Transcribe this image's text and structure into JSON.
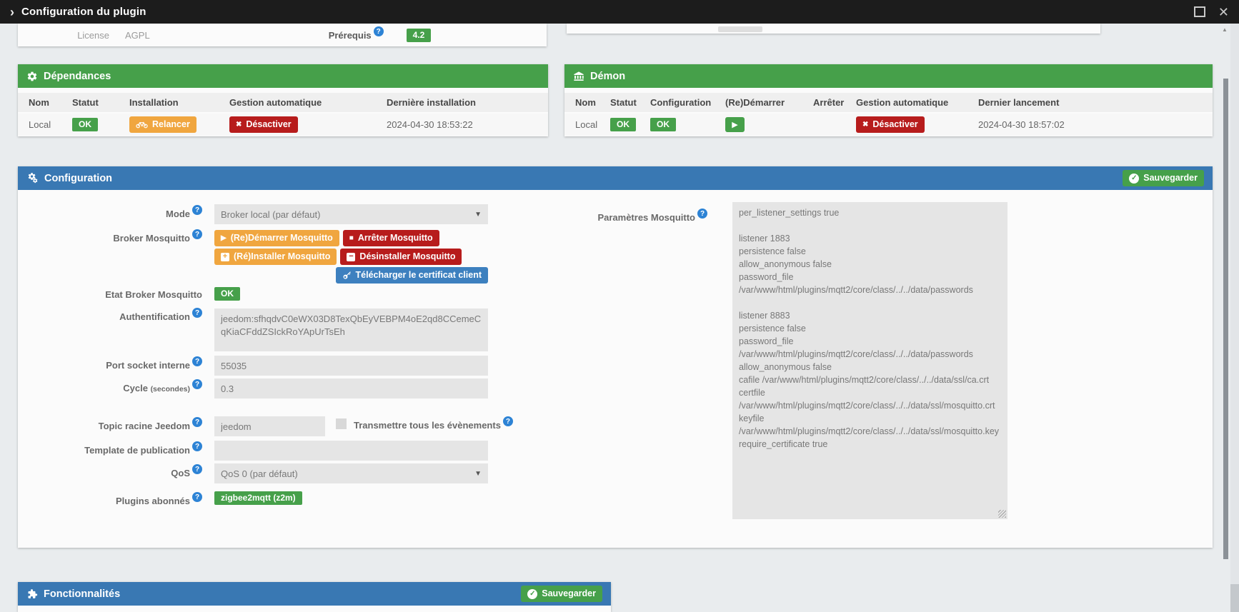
{
  "titlebar": {
    "title": "Configuration du plugin"
  },
  "icons": {
    "chevron": "›",
    "close": "✕",
    "help": "?",
    "play": "▶",
    "stop": "■",
    "xmark": "✖",
    "plus": "+",
    "minus": "−",
    "check": "✓",
    "caret": "▼",
    "scroll_up": "▲"
  },
  "top_info": {
    "license_label": "License",
    "license_value": "AGPL",
    "prerequis_label": "Prérequis",
    "prerequis_badge": "4.2"
  },
  "dependencies": {
    "title": "Dépendances",
    "headers": [
      "Nom",
      "Statut",
      "Installation",
      "Gestion automatique",
      "Dernière installation"
    ],
    "row": {
      "name": "Local",
      "status": "OK",
      "restart_label": "Relancer",
      "auto_label": "Désactiver",
      "last_install": "2024-04-30 18:53:22"
    }
  },
  "daemon": {
    "title": "Démon",
    "headers": [
      "Nom",
      "Statut",
      "Configuration",
      "(Re)Démarrer",
      "Arrêter",
      "Gestion automatique",
      "Dernier lancement"
    ],
    "row": {
      "name": "Local",
      "status": "OK",
      "config_status": "OK",
      "auto_label": "Désactiver",
      "last_launch": "2024-04-30 18:57:02"
    }
  },
  "config": {
    "title": "Configuration",
    "save_label": "Sauvegarder",
    "mode_label": "Mode",
    "mode_value": "Broker local (par défaut)",
    "broker_label": "Broker Mosquitto",
    "btn_restart": "(Re)Démarrer Mosquitto",
    "btn_stop": "Arrêter Mosquitto",
    "btn_install": "(Ré)Installer Mosquitto",
    "btn_uninstall": "Désinstaller Mosquitto",
    "btn_certificate": "Télécharger le certificat client",
    "state_label": "Etat Broker Mosquitto",
    "state_value": "OK",
    "auth_label": "Authentification",
    "auth_value": "jeedom:sfhqdvC0eWX03D8TexQbEyVEBPM4oE2qd8CCemeCqKiaCFddZSIckRoYApUrTsEh",
    "port_label": "Port socket interne",
    "port_value": "55035",
    "cycle_label": "Cycle",
    "cycle_sublabel": "(secondes)",
    "cycle_value": "0.3",
    "topic_label": "Topic racine Jeedom",
    "topic_value": "jeedom",
    "events_checkbox_label": "Transmettre tous les évènements",
    "template_label": "Template de publication",
    "template_value": "",
    "qos_label": "QoS",
    "qos_value": "QoS 0 (par défaut)",
    "plugins_label": "Plugins abonnés",
    "plugins_badge": "zigbee2mqtt (z2m)",
    "params_label": "Paramètres Mosquitto",
    "params_value": "per_listener_settings true\n\nlistener 1883\npersistence false\nallow_anonymous false\npassword_file /var/www/html/plugins/mqtt2/core/class/../../data/passwords\n\nlistener 8883\npersistence false\npassword_file /var/www/html/plugins/mqtt2/core/class/../../data/passwords\nallow_anonymous false\ncafile /var/www/html/plugins/mqtt2/core/class/../../data/ssl/ca.crt\ncertfile /var/www/html/plugins/mqtt2/core/class/../../data/ssl/mosquitto.crt\nkeyfile /var/www/html/plugins/mqtt2/core/class/../../data/ssl/mosquitto.key\nrequire_certificate true"
  },
  "features": {
    "title": "Fonctionnalités",
    "save_label": "Sauvegarder"
  },
  "colors": {
    "green": "#46a04a",
    "blue_header": "#3978b3",
    "orange": "#f0a63f",
    "red": "#b71c1c",
    "button_blue": "#3d80bf",
    "help_blue": "#2d83d5",
    "titlebar": "#1c1c1c"
  }
}
